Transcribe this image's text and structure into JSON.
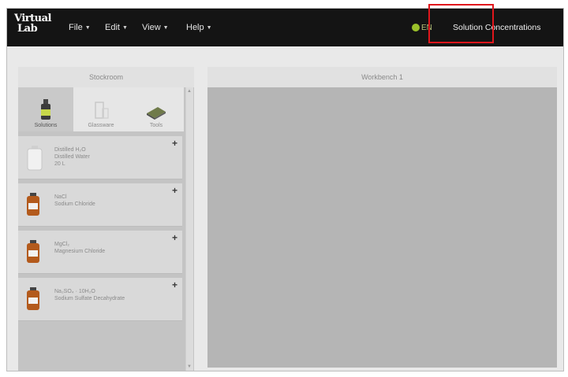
{
  "navbar": {
    "logo_line1": "Virtual",
    "logo_line2": "Lab",
    "menu": [
      {
        "label": "File"
      },
      {
        "label": "Edit"
      },
      {
        "label": "View"
      },
      {
        "label": "Help"
      }
    ],
    "lang_label": "EN",
    "lab_title": "Solution Concentrations",
    "highlight_color": "#e0161c"
  },
  "stockroom": {
    "title": "Stockroom",
    "tabs": [
      {
        "label": "Solutions",
        "icon": "solutions-bottle-icon"
      },
      {
        "label": "Glassware",
        "icon": "glassware-icon"
      },
      {
        "label": "Tools",
        "icon": "tools-icon"
      }
    ],
    "items": [
      {
        "icon": "carboy-icon",
        "lines": [
          "Distilled H₂O",
          "Distilled Water",
          "20 L"
        ]
      },
      {
        "icon": "reagent-bottle-icon",
        "lines": [
          "NaCl",
          "Sodium Chloride"
        ]
      },
      {
        "icon": "reagent-bottle-icon",
        "lines": [
          "MgCl₂",
          "Magnesium Chloride"
        ]
      },
      {
        "icon": "reagent-bottle-icon",
        "lines": [
          "Na₂SO₄ · 10H₂O",
          "Sodium Sulfate Decahydrate"
        ]
      }
    ],
    "add_symbol": "+"
  },
  "workbench": {
    "title": "Workbench 1"
  }
}
